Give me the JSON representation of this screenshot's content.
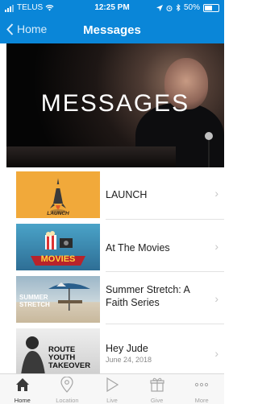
{
  "status": {
    "carrier": "TELUS",
    "time": "12:25 PM",
    "battery": "50%"
  },
  "nav": {
    "back_label": "Home",
    "title": "Messages"
  },
  "hero": {
    "title": "MESSAGES"
  },
  "items": [
    {
      "title": "LAUNCH",
      "date": "",
      "thumb_text": "LAUNCH"
    },
    {
      "title": "At The Movies",
      "date": "",
      "thumb_text": "MOVIES"
    },
    {
      "title": "Summer Stretch: A Faith Series",
      "date": "",
      "thumb_text": "SUMMER STRETCH"
    },
    {
      "title": "Hey Jude",
      "date": "June 24, 2018",
      "thumb_text": "ROUTE YOUTH TAKEOVER"
    }
  ],
  "tabs": [
    {
      "label": "Home",
      "icon": "home-icon",
      "active": true
    },
    {
      "label": "Location",
      "icon": "location-pin-icon",
      "active": false
    },
    {
      "label": "Live",
      "icon": "play-icon",
      "active": false
    },
    {
      "label": "Give",
      "icon": "gift-icon",
      "active": false
    },
    {
      "label": "More",
      "icon": "more-dots-icon",
      "active": false
    }
  ],
  "colors": {
    "accent": "#0a86d8",
    "chevron": "#c6c6c6"
  }
}
